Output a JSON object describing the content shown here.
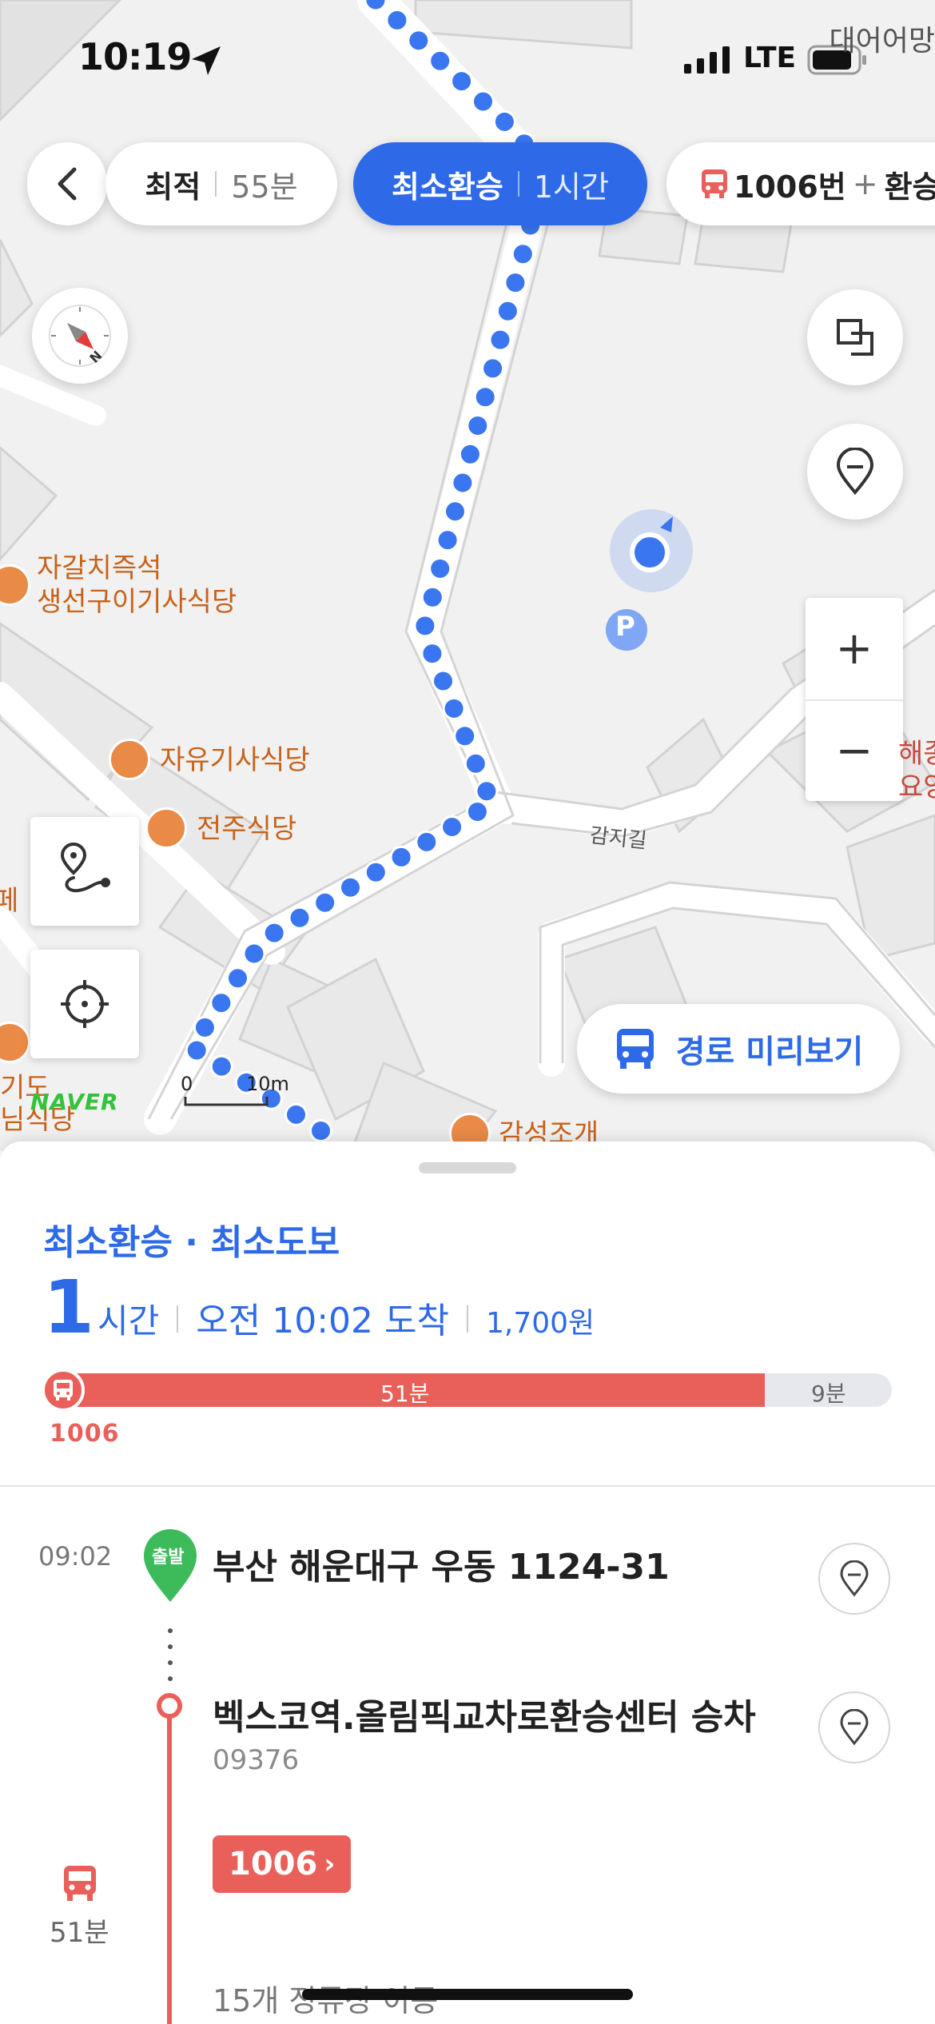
{
  "status_bar": {
    "time": "10:19",
    "network": "LTE"
  },
  "map": {
    "corner_label": "대어어망",
    "road_label": "감지길",
    "scale": {
      "left": "0",
      "right": "10m"
    },
    "brand": "NAVER",
    "pois": [
      {
        "line1": "자갈치즉석",
        "line2": "생선구이기사식당"
      },
      {
        "line1": "자유기사식당",
        "line2": ""
      },
      {
        "line1": "전주식당",
        "line2": ""
      },
      {
        "line1": "감성조개",
        "line2": ""
      }
    ],
    "partial_labels": {
      "left1": "페",
      "left2": "기도",
      "left3": "님식당",
      "right1": "해종",
      "right2": "요양"
    },
    "parking": "P",
    "preview_button": "경로 미리보기"
  },
  "route_options": [
    {
      "name": "최적",
      "time": "55분",
      "selected": false
    },
    {
      "name": "최소환승",
      "time": "1시간",
      "selected": true
    },
    {
      "name": "1006번",
      "plus": "+",
      "suffix": "환승"
    }
  ],
  "sheet": {
    "route_type": "최소환승 · 최소도보",
    "duration_value": "1",
    "duration_unit": "시간",
    "arrival": "오전 10:02 도착",
    "fare": "1,700원",
    "bar": {
      "bus_minutes_label": "51분",
      "walk_minutes_label": "9분",
      "bus_fraction": 0.85
    },
    "bus_number": "1006",
    "steps": {
      "start_time": "09:02",
      "start_tag": "출발",
      "start_address": "부산 해운대구 우동 1124-31",
      "board_stop": "벡스코역.올림픽교차로환승센터 승차",
      "board_stop_code": "09376",
      "bus_chip": "1006",
      "ride_minutes": "51분",
      "stops_move": "15개 정류장 이동"
    }
  },
  "colors": {
    "accent": "#2e6ae8",
    "bus": "#e9605a",
    "poi": "#c8621a"
  }
}
